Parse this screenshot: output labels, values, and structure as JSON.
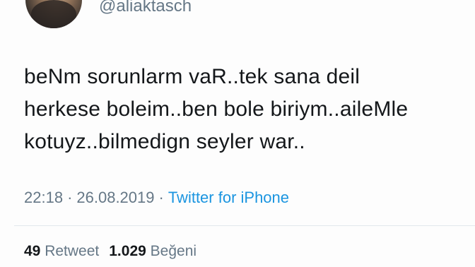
{
  "user": {
    "handle": "@aliaktasch"
  },
  "tweet": {
    "lines": [
      "beNm sorunlarm vaR..tek sana deil",
      "herkese boleim..ben bole biriym..aileMle",
      "kotuyz..bilmedign seyler war.."
    ],
    "time": "22:18",
    "separator": "·",
    "date": "26.08.2019",
    "source": "Twitter for iPhone"
  },
  "stats": {
    "retweets_count": "49",
    "retweets_label": "Retweet",
    "likes_count": "1.029",
    "likes_label": "Beğeni"
  },
  "colors": {
    "text": "#14171a",
    "muted": "#657786",
    "link": "#1b95e0",
    "divider": "#e1e8ed"
  }
}
